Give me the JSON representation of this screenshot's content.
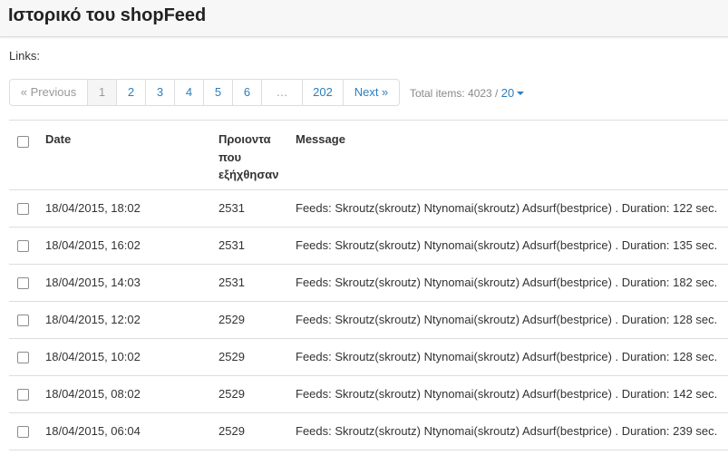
{
  "page": {
    "title": "Ιστορικό του shopFeed",
    "links_label": "Links:"
  },
  "pagination": {
    "previous": "« Previous",
    "pages": [
      "1",
      "2",
      "3",
      "4",
      "5",
      "6"
    ],
    "current": "1",
    "ellipsis": "…",
    "last": "202",
    "next": "Next »"
  },
  "summary": {
    "total_label": "Total items: 4023 / ",
    "per_page": "20"
  },
  "table": {
    "headers": {
      "date": "Date",
      "count": "Προιοντα που εξήχθησαν",
      "message": "Message"
    },
    "rows": [
      {
        "date": "18/04/2015, 18:02",
        "count": "2531",
        "message": "Feeds: Skroutz(skroutz) Ntynomai(skroutz) Adsurf(bestprice) . Duration: 122 sec."
      },
      {
        "date": "18/04/2015, 16:02",
        "count": "2531",
        "message": "Feeds: Skroutz(skroutz) Ntynomai(skroutz) Adsurf(bestprice) . Duration: 135 sec."
      },
      {
        "date": "18/04/2015, 14:03",
        "count": "2531",
        "message": "Feeds: Skroutz(skroutz) Ntynomai(skroutz) Adsurf(bestprice) . Duration: 182 sec."
      },
      {
        "date": "18/04/2015, 12:02",
        "count": "2529",
        "message": "Feeds: Skroutz(skroutz) Ntynomai(skroutz) Adsurf(bestprice) . Duration: 128 sec."
      },
      {
        "date": "18/04/2015, 10:02",
        "count": "2529",
        "message": "Feeds: Skroutz(skroutz) Ntynomai(skroutz) Adsurf(bestprice) . Duration: 128 sec."
      },
      {
        "date": "18/04/2015, 08:02",
        "count": "2529",
        "message": "Feeds: Skroutz(skroutz) Ntynomai(skroutz) Adsurf(bestprice) . Duration: 142 sec."
      },
      {
        "date": "18/04/2015, 06:04",
        "count": "2529",
        "message": "Feeds: Skroutz(skroutz) Ntynomai(skroutz) Adsurf(bestprice) . Duration: 239 sec."
      }
    ]
  },
  "colors": {
    "link": "#2a7fc1",
    "muted": "#999999",
    "border": "#dddddd"
  }
}
